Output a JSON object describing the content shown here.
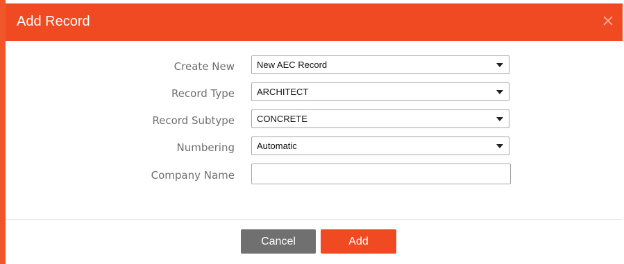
{
  "dialog": {
    "title": "Add Record",
    "close_icon": "close-icon"
  },
  "form": {
    "fields": [
      {
        "label": "Create New",
        "type": "select",
        "value": "New AEC Record"
      },
      {
        "label": "Record Type",
        "type": "select",
        "value": "ARCHITECT"
      },
      {
        "label": "Record Subtype",
        "type": "select",
        "value": "CONCRETE"
      },
      {
        "label": "Numbering",
        "type": "select",
        "value": "Automatic"
      },
      {
        "label": "Company Name",
        "type": "text",
        "value": ""
      }
    ]
  },
  "buttons": {
    "cancel_label": "Cancel",
    "add_label": "Add"
  },
  "colors": {
    "accent": "#f04a23",
    "cancel": "#707070",
    "label_text": "#6f6f6f"
  }
}
